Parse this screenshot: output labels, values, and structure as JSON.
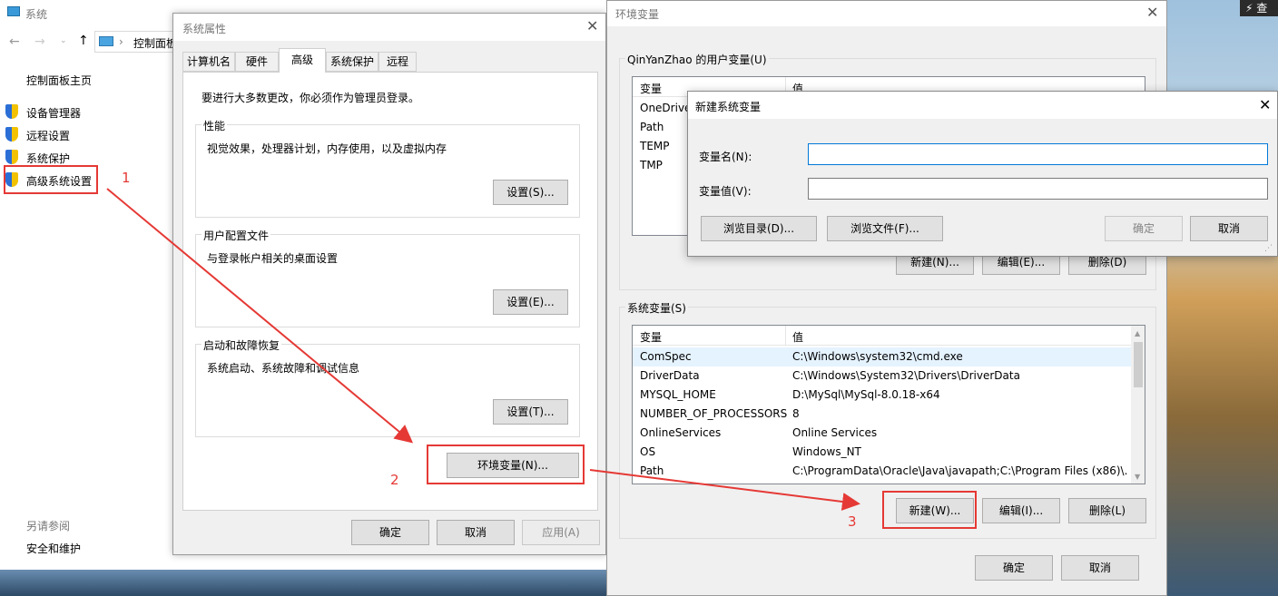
{
  "bg_window": {
    "title": "系统",
    "address": "控制面板",
    "home": "控制面板主页",
    "nav": [
      "设备管理器",
      "远程设置",
      "系统保护",
      "高级系统设置"
    ],
    "see_also_title": "另请参阅",
    "see_also_item": "安全和维护"
  },
  "sysprops": {
    "title": "系统属性",
    "tabs": [
      "计算机名",
      "硬件",
      "高级",
      "系统保护",
      "远程"
    ],
    "admin_note": "要进行大多数更改，你必须作为管理员登录。",
    "perf_title": "性能",
    "perf_desc": "视觉效果，处理器计划，内存使用，以及虚拟内存",
    "perf_btn": "设置(S)...",
    "profile_title": "用户配置文件",
    "profile_desc": "与登录帐户相关的桌面设置",
    "profile_btn": "设置(E)...",
    "startup_title": "启动和故障恢复",
    "startup_desc": "系统启动、系统故障和调试信息",
    "startup_btn": "设置(T)...",
    "env_btn": "环境变量(N)...",
    "ok": "确定",
    "cancel": "取消",
    "apply": "应用(A)"
  },
  "envvars": {
    "title": "环境变量",
    "user_group": "QinYanZhao 的用户变量(U)",
    "col_var": "变量",
    "col_val": "值",
    "user_rows": [
      {
        "name": "OneDrive"
      },
      {
        "name": "Path"
      },
      {
        "name": "TEMP"
      },
      {
        "name": "TMP"
      }
    ],
    "user_new": "新建(N)...",
    "user_edit": "编辑(E)...",
    "user_del": "删除(D)",
    "sys_group": "系统变量(S)",
    "sys_rows": [
      {
        "name": "ComSpec",
        "value": "C:\\Windows\\system32\\cmd.exe"
      },
      {
        "name": "DriverData",
        "value": "C:\\Windows\\System32\\Drivers\\DriverData"
      },
      {
        "name": "MYSQL_HOME",
        "value": "D:\\MySql\\MySql-8.0.18-x64"
      },
      {
        "name": "NUMBER_OF_PROCESSORS",
        "value": "8"
      },
      {
        "name": "OnlineServices",
        "value": "Online Services"
      },
      {
        "name": "OS",
        "value": "Windows_NT"
      },
      {
        "name": "Path",
        "value": "C:\\ProgramData\\Oracle\\Java\\javapath;C:\\Program Files (x86)\\..."
      }
    ],
    "sys_new": "新建(W)...",
    "sys_edit": "编辑(I)...",
    "sys_del": "删除(L)",
    "ok": "确定",
    "cancel": "取消"
  },
  "newvar": {
    "title": "新建系统变量",
    "name_label": "变量名(N):",
    "value_label": "变量值(V):",
    "name_value": "",
    "value_value": "",
    "browse_dir": "浏览目录(D)...",
    "browse_file": "浏览文件(F)...",
    "ok": "确定",
    "cancel": "取消"
  },
  "annotations": {
    "step1": "1",
    "step2": "2",
    "step3": "3"
  },
  "corner_text": "查",
  "colors": {
    "accent": "#e53935",
    "focus": "#0078d7"
  }
}
